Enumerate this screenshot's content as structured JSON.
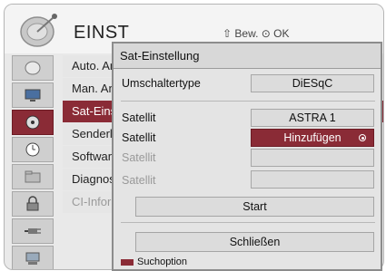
{
  "background_menu": {
    "title": "EINST",
    "hint": "⇧ Bew.   ⊙ OK",
    "items": [
      {
        "label": "Auto. An"
      },
      {
        "label": "Man. An"
      },
      {
        "label": "Sat-Einst"
      },
      {
        "label": "Senderli"
      },
      {
        "label": "Software"
      },
      {
        "label": "Diagnos"
      },
      {
        "label": "CI-Inform"
      }
    ],
    "icons": [
      "satellite-icon",
      "monitor-icon",
      "disc-icon",
      "clock-icon",
      "folder-icon",
      "lock-icon",
      "plug-icon",
      "pc-icon"
    ]
  },
  "dialog": {
    "title": "Sat-Einstellung",
    "rows": [
      {
        "label": "Umschaltertype",
        "value": "DiESqC"
      },
      {
        "label": "Satellit",
        "value": "ASTRA 1"
      },
      {
        "label": "Satellit",
        "value": "Hinzufügen"
      },
      {
        "label": "Satellit",
        "value": ""
      },
      {
        "label": "Satellit",
        "value": ""
      }
    ],
    "start_label": "Start",
    "close_label": "Schließen",
    "footer_label": "Suchoption"
  },
  "colors": {
    "accent": "#8a2b36",
    "panel": "#e4e4e4"
  }
}
